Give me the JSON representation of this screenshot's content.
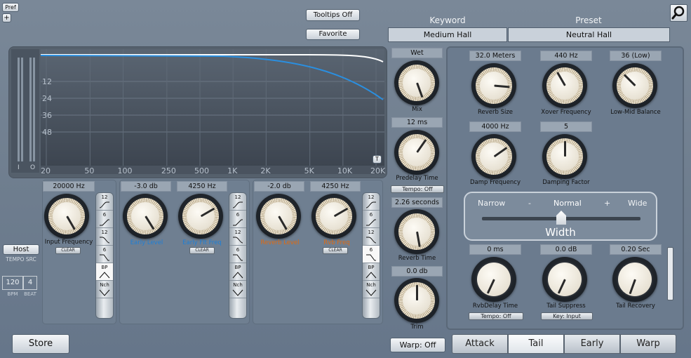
{
  "pref_button": "Pref",
  "plus_button": "+",
  "tooltips_button": "Tooltips Off",
  "favorite_button": "Favorite",
  "keyword": {
    "label": "Keyword",
    "value": "Medium Hall"
  },
  "preset": {
    "label": "Preset",
    "value": "Neutral Hall"
  },
  "search_icon": "magnifier-icon",
  "graph": {
    "db_ticks": [
      "12",
      "24",
      "36",
      "48"
    ],
    "freq_ticks": [
      "20",
      "50",
      "100",
      "250",
      "500",
      "1K",
      "2K",
      "5K",
      "10K",
      "20K"
    ],
    "io_labels": [
      "I",
      "O"
    ],
    "t_button": "T",
    "curve_color": "#2a8fe0"
  },
  "eq": {
    "input": {
      "value": "20000 Hz",
      "label": "Input Frequency",
      "clear": "CLEAR",
      "color": "#111111"
    },
    "early_level": {
      "value": "-3.0 db",
      "label": "Early Level",
      "color": "#1e7fd6"
    },
    "early_flt": {
      "value": "4250 Hz",
      "label": "Early Flt Freq",
      "clear": "CLEAR",
      "color": "#1e7fd6"
    },
    "reverb_level": {
      "value": "-2.0 db",
      "label": "Reverb Level",
      "color": "#e06a10"
    },
    "rvb_freq": {
      "value": "4250 Hz",
      "label": "Rvb Freq",
      "clear": "CLEAR",
      "color": "#e06a10"
    },
    "filter_options": [
      "12",
      "6",
      "12",
      "6",
      "BP",
      "Nch"
    ]
  },
  "tempo": {
    "host": "Host",
    "src": "TEMPO SRC",
    "bpm_value": "120",
    "beat_value": "4",
    "bpm_label": "BPM",
    "beat_label": "BEAT"
  },
  "store_button": "Store",
  "mix": {
    "value": "Wet",
    "label": "Mix"
  },
  "predelay": {
    "value": "12 ms",
    "label": "Predelay Time",
    "tempo": "Tempo: Off"
  },
  "reverb_time": {
    "value": "2.26 seconds",
    "label": "Reverb Time"
  },
  "trim": {
    "value": "0.0 db",
    "label": "Trim"
  },
  "warp_button": "Warp: Off",
  "right": {
    "reverb_size": {
      "value": "32.0 Meters",
      "label": "Reverb Size"
    },
    "xover": {
      "value": "440 Hz",
      "label": "Xover Frequency"
    },
    "lowmid": {
      "value": "36 (Low)",
      "label": "Low-Mid Balance"
    },
    "damp_freq": {
      "value": "4000 Hz",
      "label": "Damp Frequency"
    },
    "damp_factor": {
      "value": "5",
      "label": "Damping Factor"
    },
    "width": {
      "narrow": "Narrow",
      "minus": "-",
      "normal": "Normal",
      "plus": "+",
      "wide": "Wide",
      "title": "Width",
      "level": 0.5
    },
    "rvb_delay": {
      "value": "0 ms",
      "label": "RvbDelay Time",
      "tempo": "Tempo: Off"
    },
    "tail_suppress": {
      "value": "0.0 dB",
      "label": "Tail Suppress",
      "key": "Key: Input"
    },
    "tail_recovery": {
      "value": "0.20 Sec",
      "label": "Tail Recovery"
    }
  },
  "tabs": [
    "Attack",
    "Tail",
    "Early",
    "Warp"
  ],
  "active_tab": "Tail"
}
